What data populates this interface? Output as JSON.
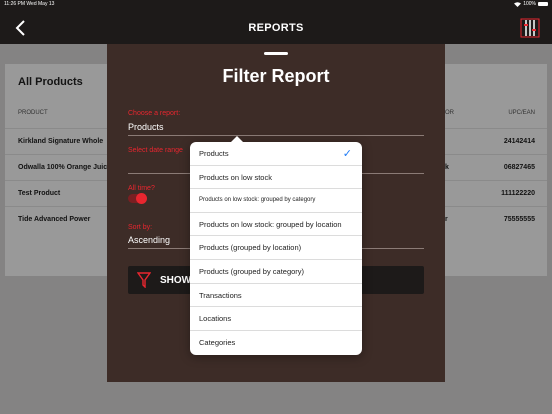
{
  "status": {
    "time": "11:26 PM  Wed May 13",
    "battery": "100%"
  },
  "nav": {
    "title": "REPORTS"
  },
  "table": {
    "title": "All Products",
    "col_product": "PRODUCT",
    "col_vendor": "OR",
    "col_upc": "UPC/EAN",
    "rows": [
      {
        "product": "Kirkland Signature Whole",
        "vendor": "",
        "upc": "24142414"
      },
      {
        "product": "Odwalla 100% Orange Juic",
        "vendor": "k",
        "upc": "06827465"
      },
      {
        "product": "Test Product",
        "vendor": "",
        "upc": "111122220"
      },
      {
        "product": "Tide Advanced Power",
        "vendor": "r",
        "upc": "75555555"
      }
    ]
  },
  "modal": {
    "title": "Filter Report",
    "report_label": "Choose a report:",
    "report_value": "Products",
    "date_label": "Select date range",
    "alltime_label": "All time?",
    "sort_label": "Sort by:",
    "sort_value": "Ascending",
    "show_label": "SHOW"
  },
  "dropdown": {
    "items": [
      "Products",
      "Products on low stock",
      "Products on low stock: grouped by category",
      "Products on low stock: grouped by location",
      "Products (grouped by location)",
      "Products (grouped by category)",
      "Transactions",
      "Locations",
      "Categories"
    ],
    "selected_check": "✓"
  },
  "colors": {
    "accent_red": "#e8262f",
    "modal_bg": "#3d2c27",
    "check_blue": "#1f7bf6"
  }
}
